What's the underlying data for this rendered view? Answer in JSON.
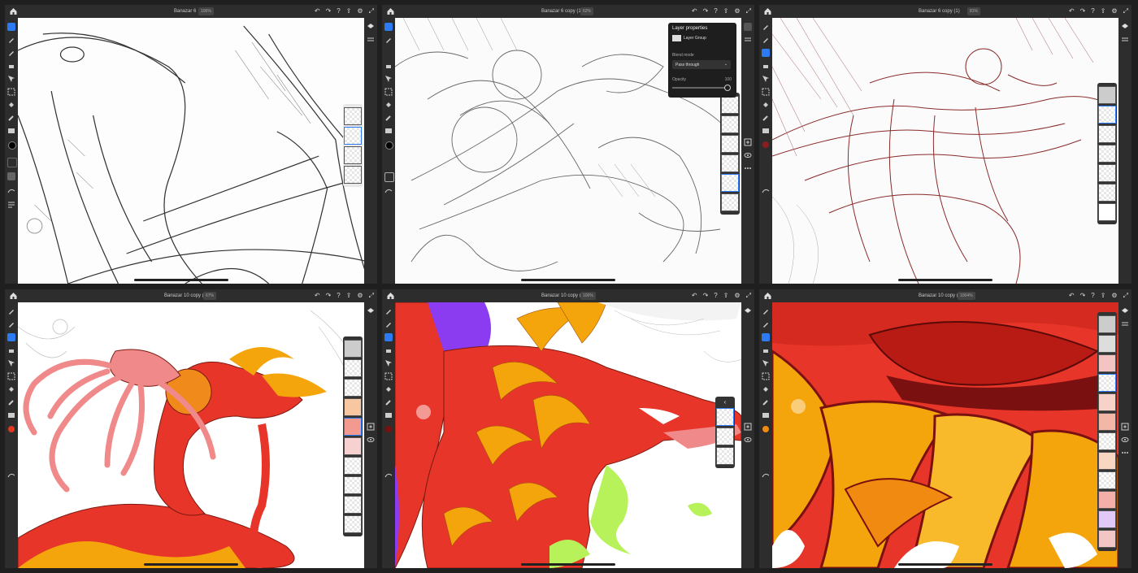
{
  "panes": [
    {
      "title": "Banazar 6",
      "zoom": "106%"
    },
    {
      "title": "Banazar 6 copy (1)",
      "zoom": "62%"
    },
    {
      "title": "Banazar 6 copy (1)",
      "zoom": "81%"
    },
    {
      "title": "Banazar 10 copy (1)",
      "zoom": "67%"
    },
    {
      "title": "Banazar 10 copy (1)",
      "zoom": "100%"
    },
    {
      "title": "Banazar 10 copy (2)",
      "zoom": "1004%"
    }
  ],
  "layer_properties": {
    "heading": "Layer properties",
    "layer_name": "Layer Group",
    "blend_label": "Blend mode",
    "blend_value": "Pass through",
    "opacity_label": "Opacity",
    "opacity_value": "100"
  },
  "colors": {
    "app_bg": "#2d2d2d",
    "accent": "#2c7bf2",
    "dragon_red": "#e8352a",
    "dragon_orange": "#f5a50c",
    "squid_pink": "#f0898a",
    "sketch_red": "#8a2b2b"
  }
}
